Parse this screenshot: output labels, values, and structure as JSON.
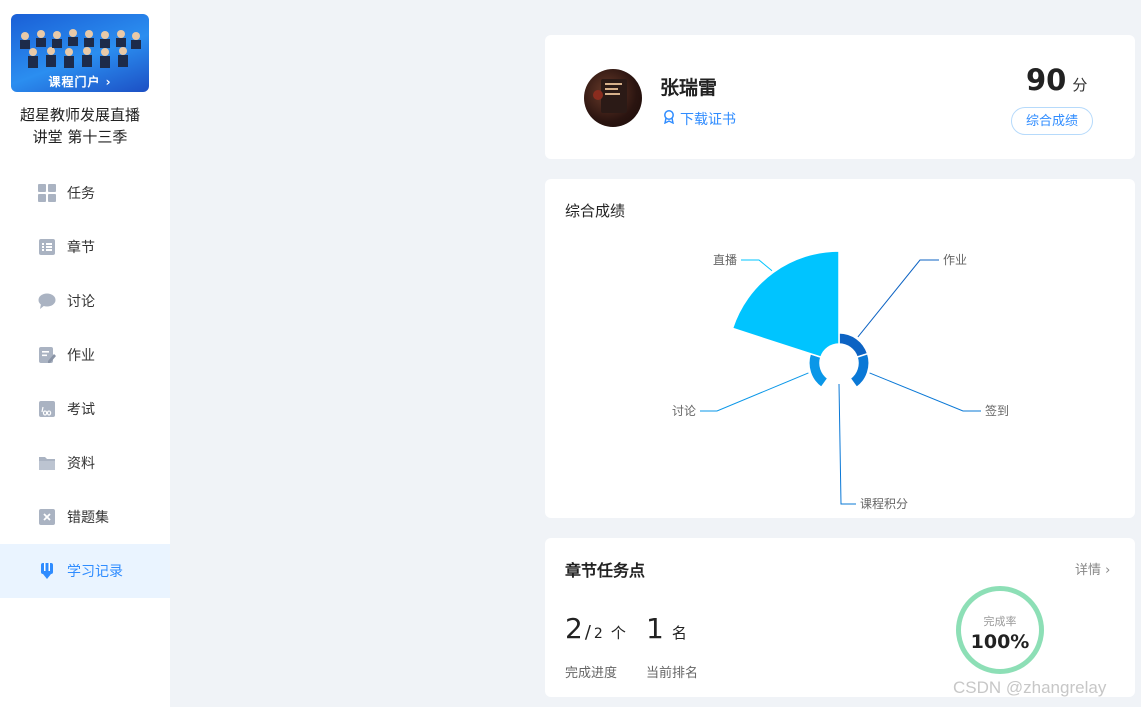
{
  "sidebar": {
    "banner_text": "课程门户 ›",
    "course_title_line1": "超星教师发展直播",
    "course_title_line2": "讲堂 第十三季",
    "items": [
      {
        "label": "任务",
        "icon": "grid-icon"
      },
      {
        "label": "章节",
        "icon": "list-icon"
      },
      {
        "label": "讨论",
        "icon": "chat-icon"
      },
      {
        "label": "作业",
        "icon": "edit-icon"
      },
      {
        "label": "考试",
        "icon": "exam-icon"
      },
      {
        "label": "资料",
        "icon": "folder-icon"
      },
      {
        "label": "错题集",
        "icon": "wrong-icon"
      },
      {
        "label": "学习记录",
        "icon": "pencil-icon",
        "active": true
      }
    ]
  },
  "profile": {
    "name": "张瑞雷",
    "cert_link": "下载证书",
    "score": "90",
    "score_unit": "分",
    "score_button": "综合成绩"
  },
  "chart_data": {
    "type": "pie",
    "title": "综合成绩",
    "categories": [
      "作业",
      "签到",
      "课程积分",
      "讨论",
      "直播"
    ],
    "values": [
      12,
      12,
      0,
      12,
      100
    ],
    "colors": [
      "#0d63c3",
      "#0a78d6",
      "#0a78d6",
      "#0a97e8",
      "#00c4ff"
    ]
  },
  "tasks": {
    "title": "章节任务点",
    "detail_link": "详情 ›",
    "done": "2",
    "total": "2",
    "count_unit": "个",
    "rank": "1",
    "rank_unit": "名",
    "progress_label": "完成进度",
    "rank_label": "当前排名",
    "rate_label": "完成率",
    "rate_value": "100%"
  },
  "watermark": "CSDN @zhangrelay"
}
